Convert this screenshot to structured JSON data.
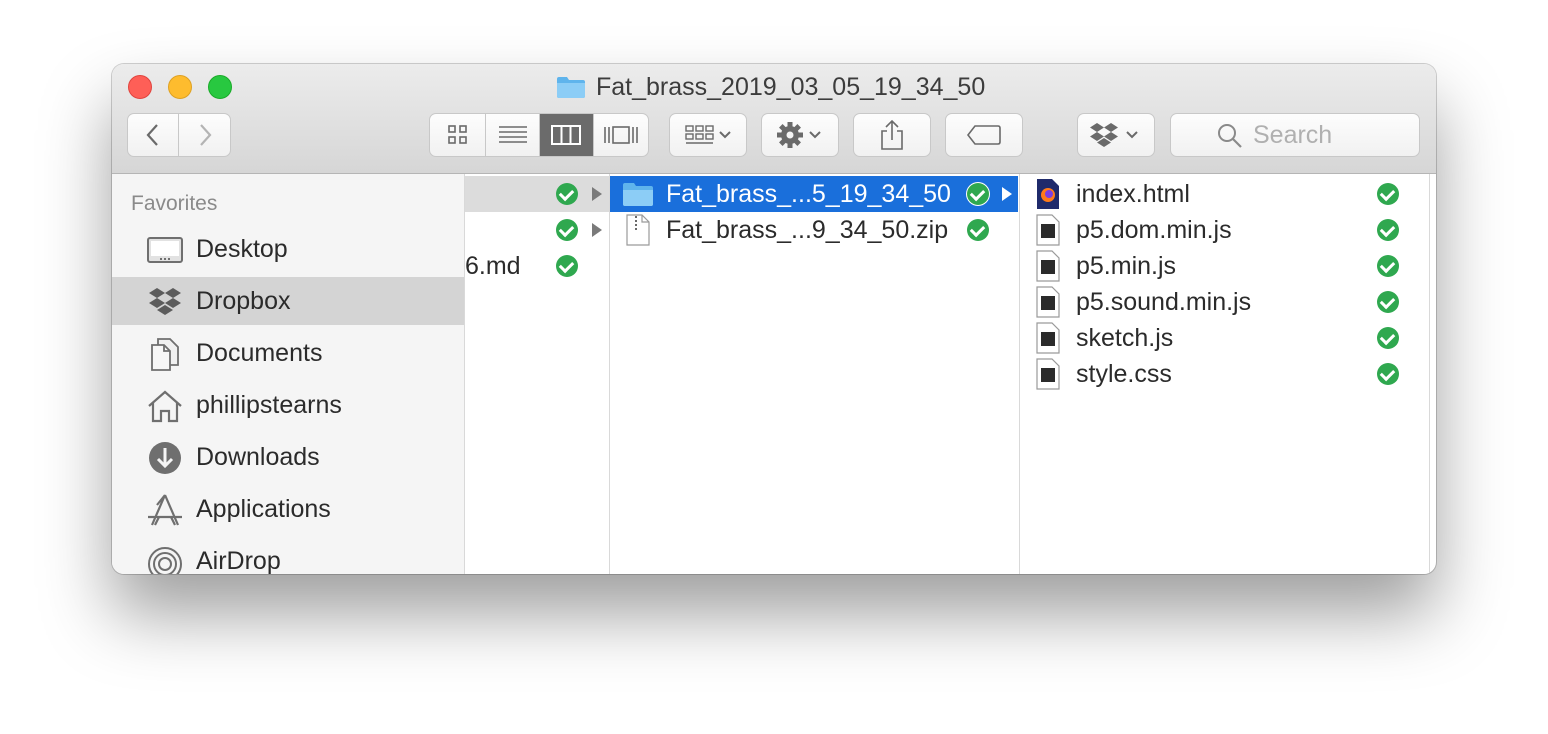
{
  "window": {
    "title": "Fat_brass_2019_03_05_19_34_50"
  },
  "toolbar": {
    "back_icon": "chevron-left-icon",
    "forward_icon": "chevron-right-icon",
    "view_modes": [
      "icon-view-icon",
      "list-view-icon",
      "column-view-icon",
      "gallery-view-icon"
    ],
    "active_view": "column-view-icon",
    "group_icon": "group-icon",
    "action_icon": "gear-icon",
    "share_icon": "share-icon",
    "tag_icon": "tag-icon",
    "dropbox_icon": "dropbox-icon",
    "search_placeholder": "Search"
  },
  "sidebar": {
    "heading": "Favorites",
    "items": [
      {
        "label": "Desktop",
        "icon": "desktop-icon",
        "selected": false
      },
      {
        "label": "Dropbox",
        "icon": "dropbox-icon",
        "selected": true
      },
      {
        "label": "Documents",
        "icon": "documents-icon",
        "selected": false
      },
      {
        "label": "phillipstearns",
        "icon": "home-icon",
        "selected": false
      },
      {
        "label": "Downloads",
        "icon": "downloads-icon",
        "selected": false
      },
      {
        "label": "Applications",
        "icon": "applications-icon",
        "selected": false
      },
      {
        "label": "AirDrop",
        "icon": "airdrop-icon",
        "selected": false
      }
    ]
  },
  "column1": {
    "rows": [
      {
        "name": "",
        "selected": true
      },
      {
        "name": "",
        "selected": false
      },
      {
        "name": "6.md",
        "selected": false
      }
    ]
  },
  "column2": {
    "rows": [
      {
        "name": "Fat_brass_...5_19_34_50",
        "kind": "folder",
        "selected": true
      },
      {
        "name": "Fat_brass_...9_34_50.zip",
        "kind": "zip",
        "selected": false
      }
    ]
  },
  "column3": {
    "rows": [
      {
        "name": "index.html",
        "icon": "firefox-html-icon"
      },
      {
        "name": "p5.dom.min.js",
        "icon": "js-file-icon"
      },
      {
        "name": "p5.min.js",
        "icon": "js-file-icon"
      },
      {
        "name": "p5.sound.min.js",
        "icon": "js-file-icon"
      },
      {
        "name": "sketch.js",
        "icon": "js-file-icon"
      },
      {
        "name": "style.css",
        "icon": "css-file-icon"
      }
    ]
  },
  "colors": {
    "selection": "#1a6fdb",
    "sync_check": "#2fa84f"
  }
}
